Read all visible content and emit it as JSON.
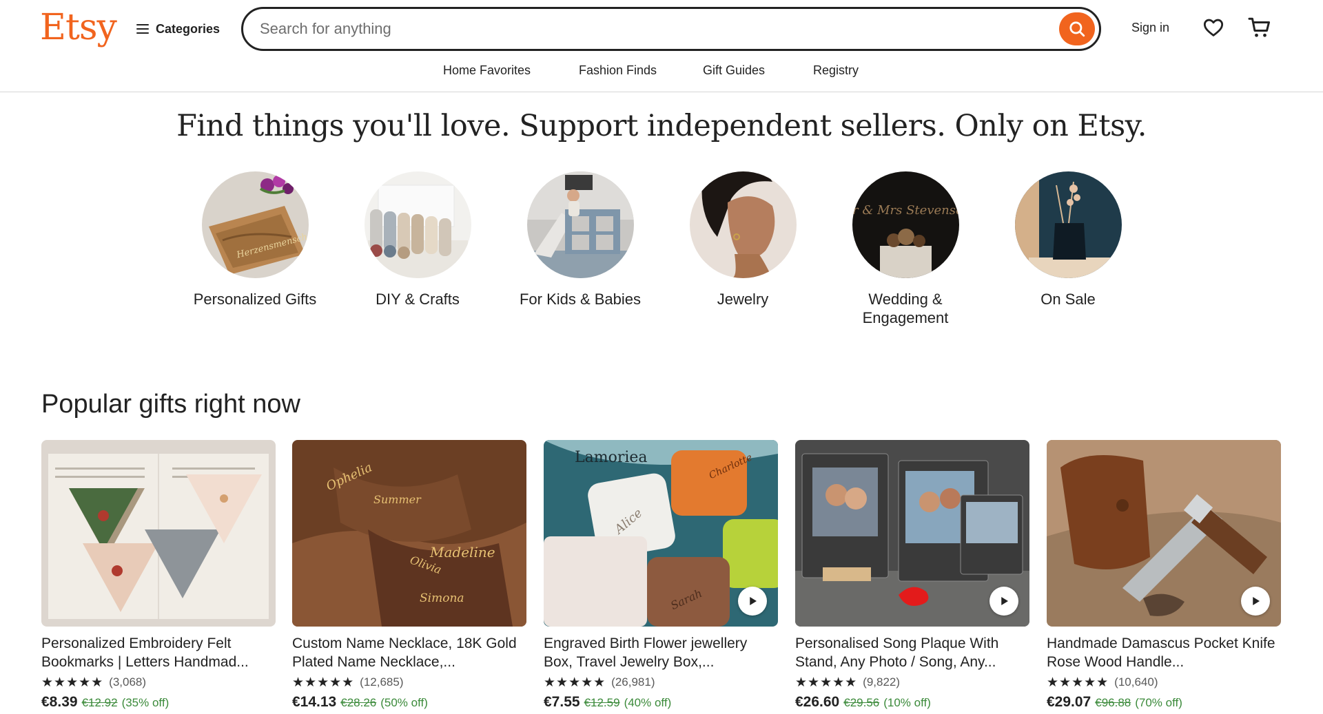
{
  "header": {
    "logo": "Etsy",
    "categories_label": "Categories",
    "search_placeholder": "Search for anything",
    "sign_in": "Sign in",
    "nav": [
      "Home Favorites",
      "Fashion Finds",
      "Gift Guides",
      "Registry"
    ]
  },
  "hero": {
    "title": "Find things you'll love. Support independent sellers. Only on Etsy.",
    "categories": [
      {
        "label": "Personalized Gifts",
        "image_text": "Herzensmensch"
      },
      {
        "label": "DIY & Crafts"
      },
      {
        "label": "For Kids & Babies"
      },
      {
        "label": "Jewelry"
      },
      {
        "label": "Wedding & Engagement",
        "image_text": "Mr & Mrs Stevenson"
      },
      {
        "label": "On Sale"
      }
    ]
  },
  "popular": {
    "title": "Popular gifts right now",
    "items": [
      {
        "title": "Personalized Embroidery Felt Bookmarks | Letters Handmad...",
        "stars": "★★★★★",
        "reviews": "(3,068)",
        "price": "€8.39",
        "original_price": "€12.92",
        "discount": "(35% off)",
        "has_video": false
      },
      {
        "title": "Custom Name Necklace, 18K Gold Plated Name Necklace,...",
        "stars": "★★★★★",
        "reviews": "(12,685)",
        "price": "€14.13",
        "original_price": "€28.26",
        "discount": "(50% off)",
        "has_video": false,
        "image_text": [
          "Ophelia",
          "Summer",
          "Madeline",
          "Olivia",
          "Simona"
        ]
      },
      {
        "title": "Engraved Birth Flower jewellery Box, Travel Jewelry Box,...",
        "stars": "★★★★★",
        "reviews": "(26,981)",
        "price": "€7.55",
        "original_price": "€12.59",
        "discount": "(40% off)",
        "has_video": true,
        "image_text": [
          "Lamoriea",
          "Alice",
          "Charlotte",
          "Sarah"
        ]
      },
      {
        "title": "Personalised Song Plaque With Stand, Any Photo / Song, Any...",
        "stars": "★★★★★",
        "reviews": "(9,822)",
        "price": "€26.60",
        "original_price": "€29.56",
        "discount": "(10% off)",
        "has_video": true
      },
      {
        "title": "Handmade Damascus Pocket Knife Rose Wood Handle...",
        "stars": "★★★★★",
        "reviews": "(10,640)",
        "price": "€29.07",
        "original_price": "€96.88",
        "discount": "(70% off)",
        "has_video": true
      }
    ]
  },
  "colors": {
    "brand": "#f1641e",
    "sale": "#3b8a3a",
    "text": "#222222"
  },
  "icons": [
    "hamburger-icon",
    "search-icon",
    "heart-icon",
    "cart-icon",
    "play-icon"
  ]
}
